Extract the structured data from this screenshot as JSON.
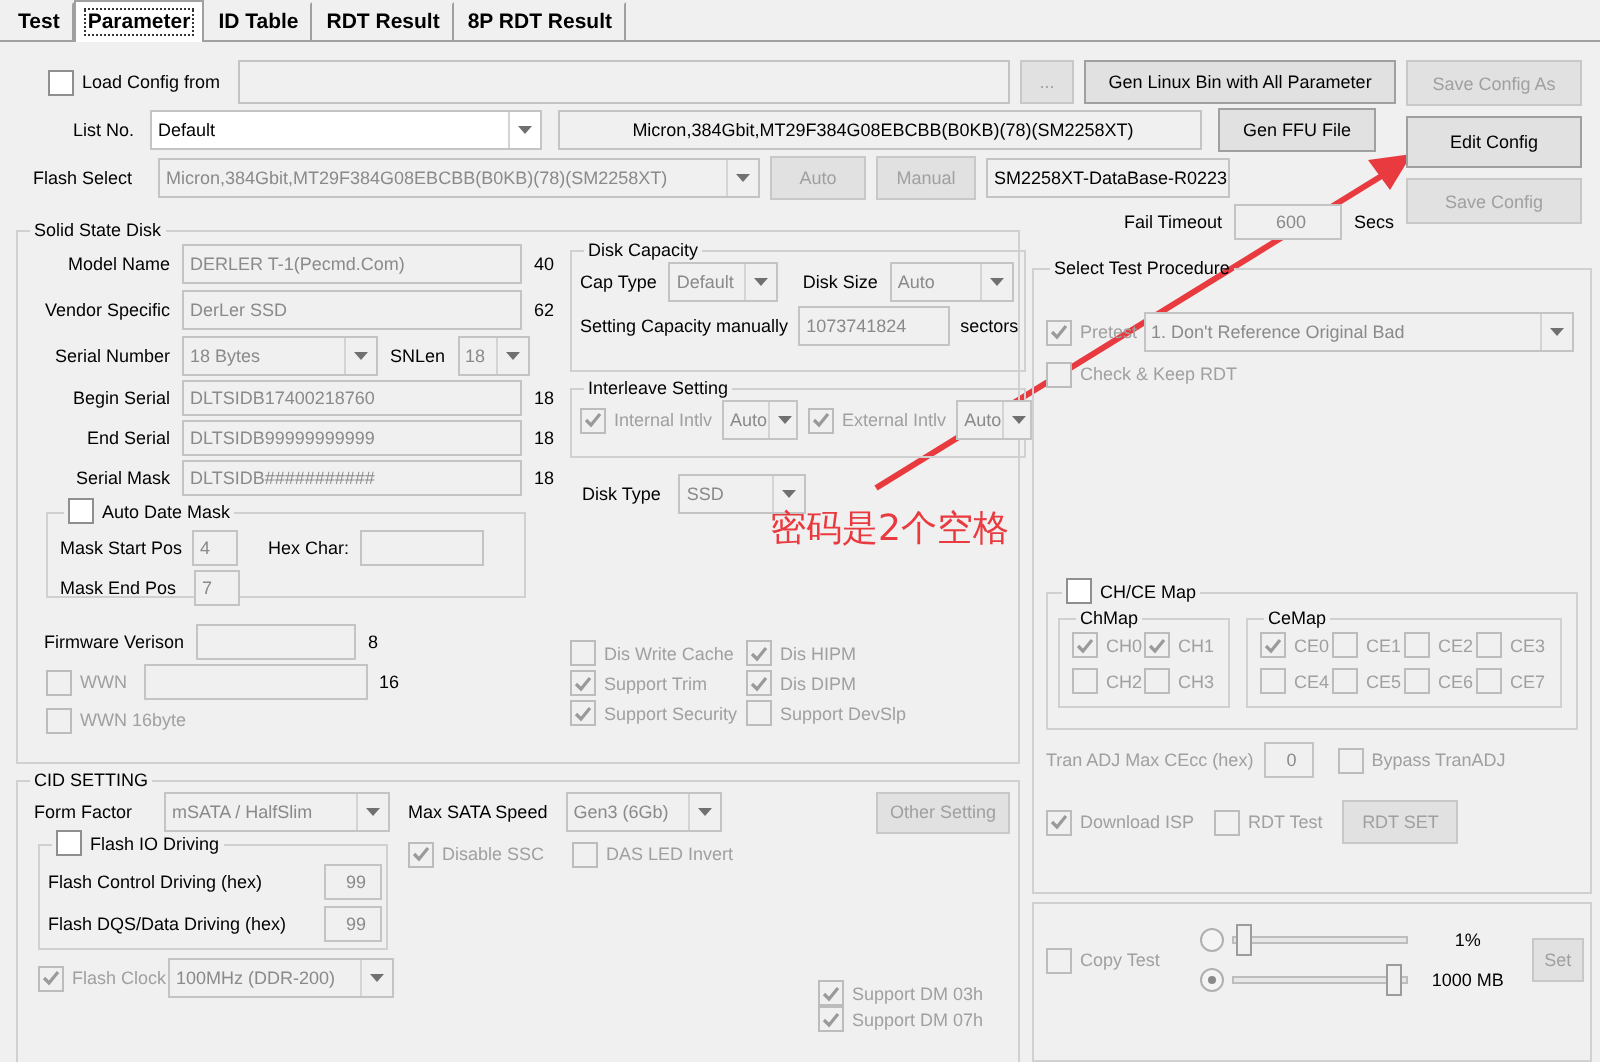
{
  "tabs": [
    {
      "label": "Test",
      "selected": false
    },
    {
      "label": "Parameter",
      "selected": true
    },
    {
      "label": "ID Table",
      "selected": false
    },
    {
      "label": "RDT Result",
      "selected": false
    },
    {
      "label": "8P RDT Result",
      "selected": false
    }
  ],
  "load_config": {
    "label": "Load Config from",
    "checked": false,
    "browse_button": "..."
  },
  "gen_linux_button": "Gen Linux Bin with All Parameter",
  "list_no": {
    "label": "List No.",
    "value": "Default"
  },
  "flash_info": "Micron,384Gbit,MT29F384G08EBCBB(B0KB)(78)(SM2258XT)",
  "gen_ffu_button": "Gen FFU File",
  "flash_select": {
    "label": "Flash Select",
    "value": "Micron,384Gbit,MT29F384G08EBCBB(B0KB)(78)(SM2258XT)"
  },
  "auto_button": "Auto",
  "manual_button": "Manual",
  "database": "SM2258XT-DataBase-R0223",
  "fail_timeout": {
    "label": "Fail Timeout",
    "value": "600",
    "unit": "Secs"
  },
  "side_buttons": [
    {
      "label": "Save Config As",
      "disabled": true
    },
    {
      "label": "Edit Config",
      "disabled": false
    },
    {
      "label": "Save Config",
      "disabled": true
    }
  ],
  "solid_state_disk": {
    "title": "Solid State Disk",
    "fields": [
      {
        "label": "Model Name",
        "value": "DERLER T-1(Pecmd.Com)",
        "length": "40"
      },
      {
        "label": "Vendor Specific",
        "value": "DerLer SSD",
        "length": "62"
      }
    ],
    "serial_number": {
      "label": "Serial Number",
      "value": "18 Bytes",
      "snlen_label": "SNLen",
      "snlen": "18"
    },
    "serial_fields": [
      {
        "label": "Begin Serial",
        "value": "DLTSIDB17400218760",
        "length": "18"
      },
      {
        "label": "End Serial",
        "value": "DLTSIDB99999999999",
        "length": "18"
      },
      {
        "label": "Serial Mask",
        "value": "DLTSIDB###########",
        "length": "18"
      }
    ],
    "auto_date_mask": {
      "label": "Auto Date Mask",
      "checked": false,
      "start_label": "Mask Start Pos",
      "start": "4",
      "hex_label": "Hex Char:",
      "end_label": "Mask End Pos",
      "end": "7"
    },
    "firmware": {
      "label": "Firmware Verison",
      "length": "8"
    },
    "wwn": {
      "label": "WWN",
      "checked": false,
      "disabled": true,
      "length": "16"
    },
    "wwn16": {
      "label": "WWN 16byte",
      "checked": false,
      "disabled": true
    },
    "disk_capacity": {
      "title": "Disk Capacity",
      "cap_type_label": "Cap Type",
      "cap_type": "Default",
      "disk_size_label": "Disk Size",
      "disk_size": "Auto",
      "manual_label": "Setting Capacity manually",
      "manual_value": "1073741824",
      "unit": "sectors"
    },
    "interleave": {
      "title": "Interleave Setting",
      "items": [
        {
          "label": "Internal Intlv",
          "checked": true,
          "disabled": true,
          "value": "Auto"
        },
        {
          "label": "External Intlv",
          "checked": true,
          "disabled": true,
          "value": "Auto"
        }
      ]
    },
    "disk_type": {
      "label": "Disk Type",
      "value": "SSD"
    },
    "options": [
      {
        "label": "Dis Write Cache",
        "checked": false,
        "disabled": true
      },
      {
        "label": "Dis HIPM",
        "checked": true,
        "disabled": true
      },
      {
        "label": "Support Trim",
        "checked": true,
        "disabled": true
      },
      {
        "label": "Dis DIPM",
        "checked": true,
        "disabled": true
      },
      {
        "label": "Support Security",
        "checked": true,
        "disabled": true
      },
      {
        "label": "Support DevSlp",
        "checked": false,
        "disabled": true
      }
    ]
  },
  "cid_setting": {
    "title": "CID SETTING",
    "form_factor": {
      "label": "Form Factor",
      "value": "mSATA / HalfSlim"
    },
    "max_sata": {
      "label": "Max SATA Speed",
      "value": "Gen3 (6Gb)"
    },
    "other_button": "Other Setting",
    "flash_io": {
      "label": "Flash IO Driving",
      "checked": false,
      "rows": [
        {
          "label": "Flash Control Driving (hex)",
          "value": "99"
        },
        {
          "label": "Flash DQS/Data Driving (hex)",
          "value": "99"
        }
      ]
    },
    "flags": [
      {
        "label": "Disable SSC",
        "checked": true,
        "disabled": true
      },
      {
        "label": "DAS LED Invert",
        "checked": false,
        "disabled": true
      }
    ],
    "flash_clock": {
      "label": "Flash Clock",
      "checked": true,
      "disabled": true,
      "value": "100MHz (DDR-200)"
    },
    "support_dm": [
      {
        "label": "Support DM 03h",
        "checked": true,
        "disabled": true
      },
      {
        "label": "Support DM 07h",
        "checked": true,
        "disabled": true
      }
    ]
  },
  "test_procedure": {
    "title": "Select Test Procedure",
    "pretest": {
      "label": "Pretest",
      "checked": true,
      "disabled": true,
      "value": "1. Don't Reference Original Bad"
    },
    "check_keep": {
      "label": "Check & Keep RDT",
      "checked": false,
      "disabled": true
    },
    "ch_ce_map": {
      "label": "CH/CE Map",
      "checked": false,
      "chmap": {
        "title": "ChMap",
        "items": [
          {
            "label": "CH0",
            "checked": true
          },
          {
            "label": "CH1",
            "checked": true
          },
          {
            "label": "CH2",
            "checked": false
          },
          {
            "label": "CH3",
            "checked": false
          }
        ]
      },
      "cemap": {
        "title": "CeMap",
        "items": [
          {
            "label": "CE0",
            "checked": true
          },
          {
            "label": "CE1",
            "checked": false
          },
          {
            "label": "CE2",
            "checked": false
          },
          {
            "label": "CE3",
            "checked": false
          },
          {
            "label": "CE4",
            "checked": false
          },
          {
            "label": "CE5",
            "checked": false
          },
          {
            "label": "CE6",
            "checked": false
          },
          {
            "label": "CE7",
            "checked": false
          }
        ]
      }
    },
    "tran_adj": {
      "label": "Tran ADJ Max CEcc (hex)",
      "value": "0"
    },
    "bypass": {
      "label": "Bypass TranADJ",
      "checked": false,
      "disabled": true
    },
    "download_isp": {
      "label": "Download ISP",
      "checked": true,
      "disabled": true
    },
    "rdt_test": {
      "label": "RDT Test",
      "checked": false,
      "disabled": true
    },
    "rdt_set_button": "RDT SET"
  },
  "copy_test": {
    "label": "Copy Test",
    "checked": false,
    "disabled": true,
    "options": [
      {
        "selected": false,
        "level": 0.03,
        "reading": "1%"
      },
      {
        "selected": true,
        "level": 0.97,
        "reading": "1000 MB"
      }
    ],
    "set_button": "Set"
  },
  "annotation": {
    "text": "密码是2个空格"
  }
}
